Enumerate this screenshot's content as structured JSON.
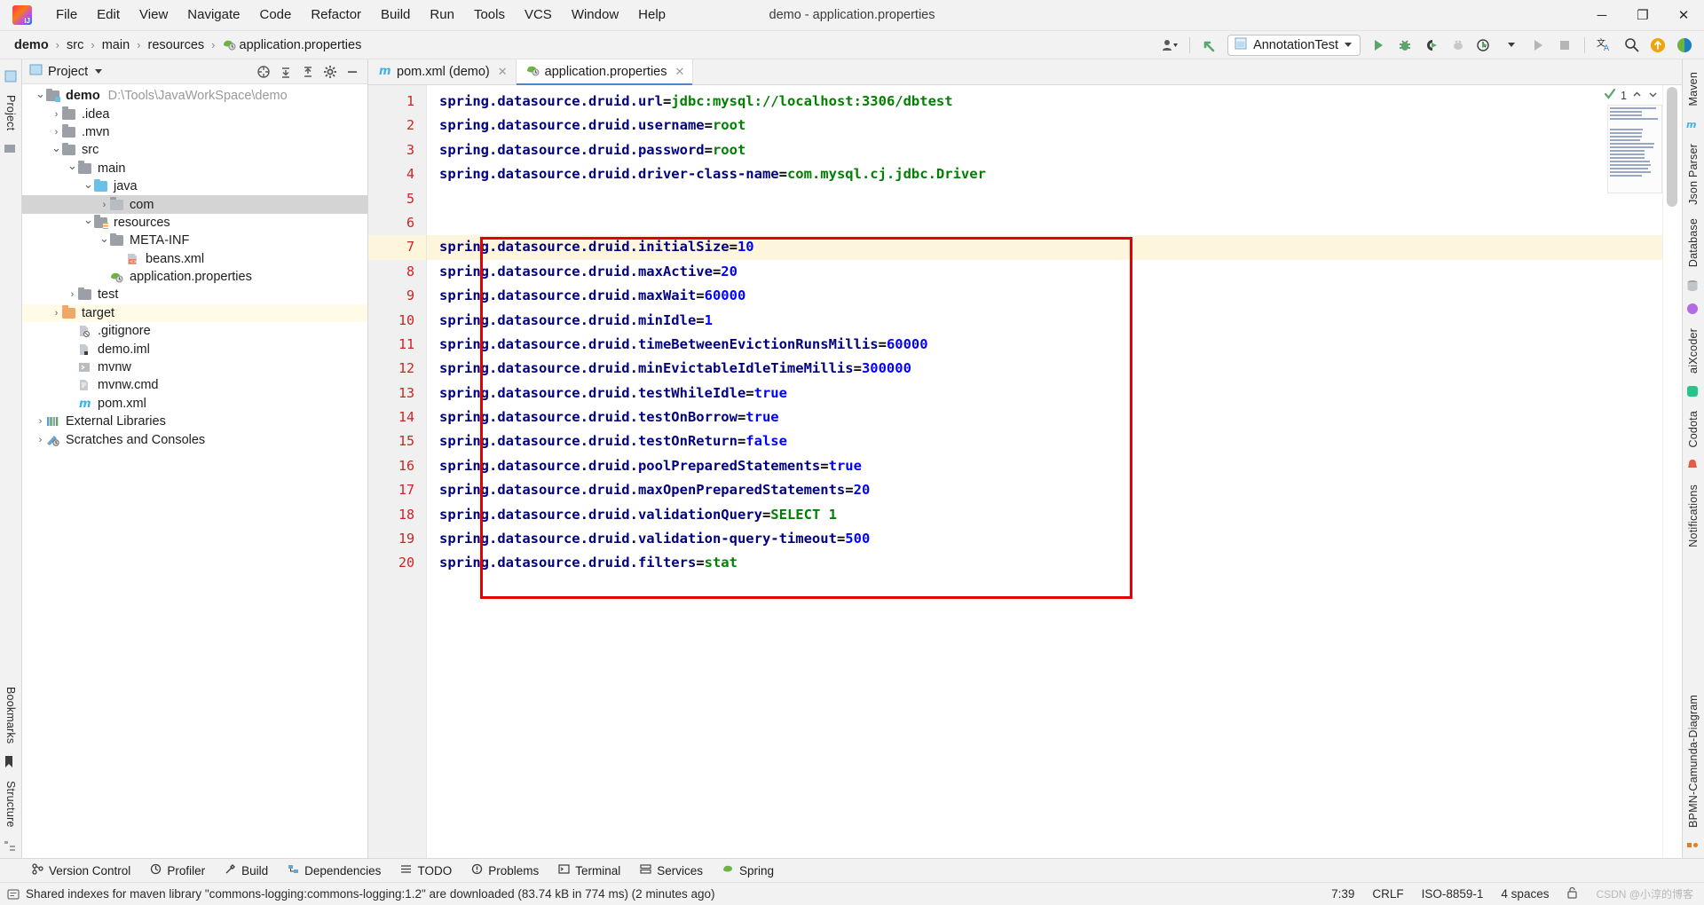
{
  "window": {
    "title": "demo - application.properties",
    "logo_icon": "intellij-idea-logo",
    "minimize_label": "─",
    "maximize_label": "❐",
    "close_label": "✕"
  },
  "menubar": {
    "items": [
      {
        "label": "File"
      },
      {
        "label": "Edit"
      },
      {
        "label": "View"
      },
      {
        "label": "Navigate"
      },
      {
        "label": "Code"
      },
      {
        "label": "Refactor"
      },
      {
        "label": "Build"
      },
      {
        "label": "Run"
      },
      {
        "label": "Tools"
      },
      {
        "label": "VCS"
      },
      {
        "label": "Window"
      },
      {
        "label": "Help"
      }
    ]
  },
  "breadcrumb": {
    "items": [
      {
        "label": "demo",
        "bold": true,
        "icon": null
      },
      {
        "label": "src",
        "bold": false,
        "icon": null
      },
      {
        "label": "main",
        "bold": false,
        "icon": null
      },
      {
        "label": "resources",
        "bold": false,
        "icon": null
      },
      {
        "label": "application.properties",
        "bold": false,
        "icon": "spring-properties-icon"
      }
    ],
    "separator": "›"
  },
  "toolbar": {
    "search_everywhere_icon": "search-icon",
    "settings_icon": "gear-icon",
    "user_icon": "user-account-icon",
    "update_icon": "update-project-icon",
    "run_config_name": "AnnotationTest",
    "run_config_icon": "application-config-icon",
    "run_icon": "run-icon",
    "debug_icon": "debug-icon",
    "run_coverage_icon": "run-with-coverage-icon",
    "profiler_icon": "profiler-icon",
    "run_dropdown_icon": "run-dashboard-icon",
    "stop_icon": "stop-icon",
    "translate_icon": "translate-icon",
    "search_icon": "magnifier-icon",
    "notification_icon": "upload-circle-icon",
    "ide_icon": "ide-circle-icon"
  },
  "project_panel": {
    "title": "Project",
    "dropdown_icon": "chevron-down-icon",
    "actions": [
      {
        "name": "select-opened-file-icon"
      },
      {
        "name": "expand-all-icon"
      },
      {
        "name": "collapse-all-icon"
      },
      {
        "name": "gear-icon"
      },
      {
        "name": "hide-icon"
      }
    ],
    "tree": [
      {
        "label": "demo",
        "path": "D:\\Tools\\JavaWorkSpace\\demo",
        "depth": 0,
        "arrow": "expanded",
        "icon": "module-folder-icon",
        "bold": true,
        "state": "normal"
      },
      {
        "label": ".idea",
        "path": "",
        "depth": 1,
        "arrow": "collapsed",
        "icon": "folder-icon",
        "bold": false,
        "state": "normal"
      },
      {
        "label": ".mvn",
        "path": "",
        "depth": 1,
        "arrow": "collapsed",
        "icon": "folder-icon",
        "bold": false,
        "state": "normal"
      },
      {
        "label": "src",
        "path": "",
        "depth": 1,
        "arrow": "expanded",
        "icon": "folder-icon",
        "bold": false,
        "state": "normal"
      },
      {
        "label": "main",
        "path": "",
        "depth": 2,
        "arrow": "expanded",
        "icon": "folder-icon",
        "bold": false,
        "state": "normal"
      },
      {
        "label": "java",
        "path": "",
        "depth": 3,
        "arrow": "expanded",
        "icon": "source-folder-icon",
        "bold": false,
        "state": "normal"
      },
      {
        "label": "com",
        "path": "",
        "depth": 4,
        "arrow": "collapsed",
        "icon": "package-folder-icon",
        "bold": false,
        "state": "selected"
      },
      {
        "label": "resources",
        "path": "",
        "depth": 3,
        "arrow": "expanded",
        "icon": "resources-folder-icon",
        "bold": false,
        "state": "normal"
      },
      {
        "label": "META-INF",
        "path": "",
        "depth": 4,
        "arrow": "expanded",
        "icon": "folder-icon",
        "bold": false,
        "state": "normal"
      },
      {
        "label": "beans.xml",
        "path": "",
        "depth": 5,
        "arrow": "none",
        "icon": "xml-file-icon",
        "bold": false,
        "state": "normal"
      },
      {
        "label": "application.properties",
        "path": "",
        "depth": 4,
        "arrow": "none",
        "icon": "spring-properties-icon",
        "bold": false,
        "state": "normal"
      },
      {
        "label": "test",
        "path": "",
        "depth": 2,
        "arrow": "collapsed",
        "icon": "folder-icon",
        "bold": false,
        "state": "normal"
      },
      {
        "label": "target",
        "path": "",
        "depth": 1,
        "arrow": "collapsed",
        "icon": "excluded-folder-icon",
        "bold": false,
        "state": "highlighted"
      },
      {
        "label": ".gitignore",
        "path": "",
        "depth": 2,
        "arrow": "none",
        "icon": "gitignore-file-icon",
        "bold": false,
        "state": "normal"
      },
      {
        "label": "demo.iml",
        "path": "",
        "depth": 2,
        "arrow": "none",
        "icon": "iml-file-icon",
        "bold": false,
        "state": "normal"
      },
      {
        "label": "mvnw",
        "path": "",
        "depth": 2,
        "arrow": "none",
        "icon": "shell-script-icon",
        "bold": false,
        "state": "normal"
      },
      {
        "label": "mvnw.cmd",
        "path": "",
        "depth": 2,
        "arrow": "none",
        "icon": "cmd-file-icon",
        "bold": false,
        "state": "normal"
      },
      {
        "label": "pom.xml",
        "path": "",
        "depth": 2,
        "arrow": "none",
        "icon": "maven-pom-icon",
        "bold": false,
        "state": "normal"
      },
      {
        "label": "External Libraries",
        "path": "",
        "depth": 0,
        "arrow": "collapsed",
        "icon": "libraries-icon",
        "bold": false,
        "state": "normal"
      },
      {
        "label": "Scratches and Consoles",
        "path": "",
        "depth": 0,
        "arrow": "collapsed",
        "icon": "scratches-icon",
        "bold": false,
        "state": "normal"
      }
    ]
  },
  "editor": {
    "tabs": [
      {
        "label": "pom.xml (demo)",
        "icon": "maven-pom-icon",
        "active": false,
        "close_label": "✕"
      },
      {
        "label": "application.properties",
        "icon": "spring-properties-icon",
        "active": true,
        "close_label": "✕"
      }
    ],
    "inspection": {
      "count": "1",
      "ok_icon": "inspections-ok-icon",
      "up_icon": "chevron-up-icon",
      "down_icon": "chevron-down-icon"
    },
    "current_line": 7,
    "lines": [
      {
        "n": 1,
        "key": "spring.datasource.druid.url",
        "value": "jdbc:mysql://localhost:3306/dbtest",
        "vtype": "string"
      },
      {
        "n": 2,
        "key": "spring.datasource.druid.username",
        "value": "root",
        "vtype": "string"
      },
      {
        "n": 3,
        "key": "spring.datasource.druid.password",
        "value": "root",
        "vtype": "string"
      },
      {
        "n": 4,
        "key": "spring.datasource.druid.driver-class-name",
        "value": "com.mysql.cj.jdbc.Driver",
        "vtype": "string"
      },
      {
        "n": 5,
        "key": "",
        "value": "",
        "vtype": "none"
      },
      {
        "n": 6,
        "key": "",
        "value": "",
        "vtype": "none"
      },
      {
        "n": 7,
        "key": "spring.datasource.druid.initialSize",
        "value": "10",
        "vtype": "number"
      },
      {
        "n": 8,
        "key": "spring.datasource.druid.maxActive",
        "value": "20",
        "vtype": "number"
      },
      {
        "n": 9,
        "key": "spring.datasource.druid.maxWait",
        "value": "60000",
        "vtype": "number"
      },
      {
        "n": 10,
        "key": "spring.datasource.druid.minIdle",
        "value": "1",
        "vtype": "number"
      },
      {
        "n": 11,
        "key": "spring.datasource.druid.timeBetweenEvictionRunsMillis",
        "value": "60000",
        "vtype": "number"
      },
      {
        "n": 12,
        "key": "spring.datasource.druid.minEvictableIdleTimeMillis",
        "value": "300000",
        "vtype": "number"
      },
      {
        "n": 13,
        "key": "spring.datasource.druid.testWhileIdle",
        "value": "true",
        "vtype": "number"
      },
      {
        "n": 14,
        "key": "spring.datasource.druid.testOnBorrow",
        "value": "true",
        "vtype": "number"
      },
      {
        "n": 15,
        "key": "spring.datasource.druid.testOnReturn",
        "value": "false",
        "vtype": "number"
      },
      {
        "n": 16,
        "key": "spring.datasource.druid.poolPreparedStatements",
        "value": "true",
        "vtype": "number"
      },
      {
        "n": 17,
        "key": "spring.datasource.druid.maxOpenPreparedStatements",
        "value": "20",
        "vtype": "number"
      },
      {
        "n": 18,
        "key": "spring.datasource.druid.validationQuery",
        "value": "SELECT 1",
        "vtype": "string"
      },
      {
        "n": 19,
        "key": "spring.datasource.druid.validation-query-timeout",
        "value": "500",
        "vtype": "number"
      },
      {
        "n": 20,
        "key": "spring.datasource.druid.filters",
        "value": "stat",
        "vtype": "string"
      }
    ]
  },
  "left_strip": {
    "labels": [
      "Project",
      "Bookmarks",
      "Structure"
    ]
  },
  "right_strip": {
    "labels": [
      "Maven",
      "Json Parser",
      "Database",
      "aiXcoder",
      "Codota",
      "Notifications",
      "BPMN-Camunda-Diagram"
    ]
  },
  "tool_windows": {
    "items": [
      {
        "label": "Version Control",
        "icon": "version-control-icon"
      },
      {
        "label": "Profiler",
        "icon": "profiler-icon"
      },
      {
        "label": "Build",
        "icon": "build-icon"
      },
      {
        "label": "Dependencies",
        "icon": "dependencies-icon"
      },
      {
        "label": "TODO",
        "icon": "todo-icon"
      },
      {
        "label": "Problems",
        "icon": "problems-icon"
      },
      {
        "label": "Terminal",
        "icon": "terminal-icon"
      },
      {
        "label": "Services",
        "icon": "services-icon"
      },
      {
        "label": "Spring",
        "icon": "spring-icon"
      }
    ]
  },
  "status_bar": {
    "message": "Shared indexes for maven library \"commons-logging:commons-logging:1.2\" are downloaded (83.74 kB in 774 ms) (2 minutes ago)",
    "message_icon": "info-icon",
    "caret_position": "7:39",
    "line_separator": "CRLF",
    "encoding": "ISO-8859-1",
    "indent": "4 spaces",
    "lock_icon": "unlocked-icon",
    "watermark": "CSDN @小淳的博客"
  },
  "colors": {
    "accent": "#4a88c7",
    "annotation_red": "#e60000",
    "key_blue": "#000080",
    "value_green": "#008000",
    "value_blue": "#0000ff",
    "line_number_red": "#cf2222",
    "caret_line": "#fdf6dd",
    "selection_gray": "#d4d4d4"
  }
}
